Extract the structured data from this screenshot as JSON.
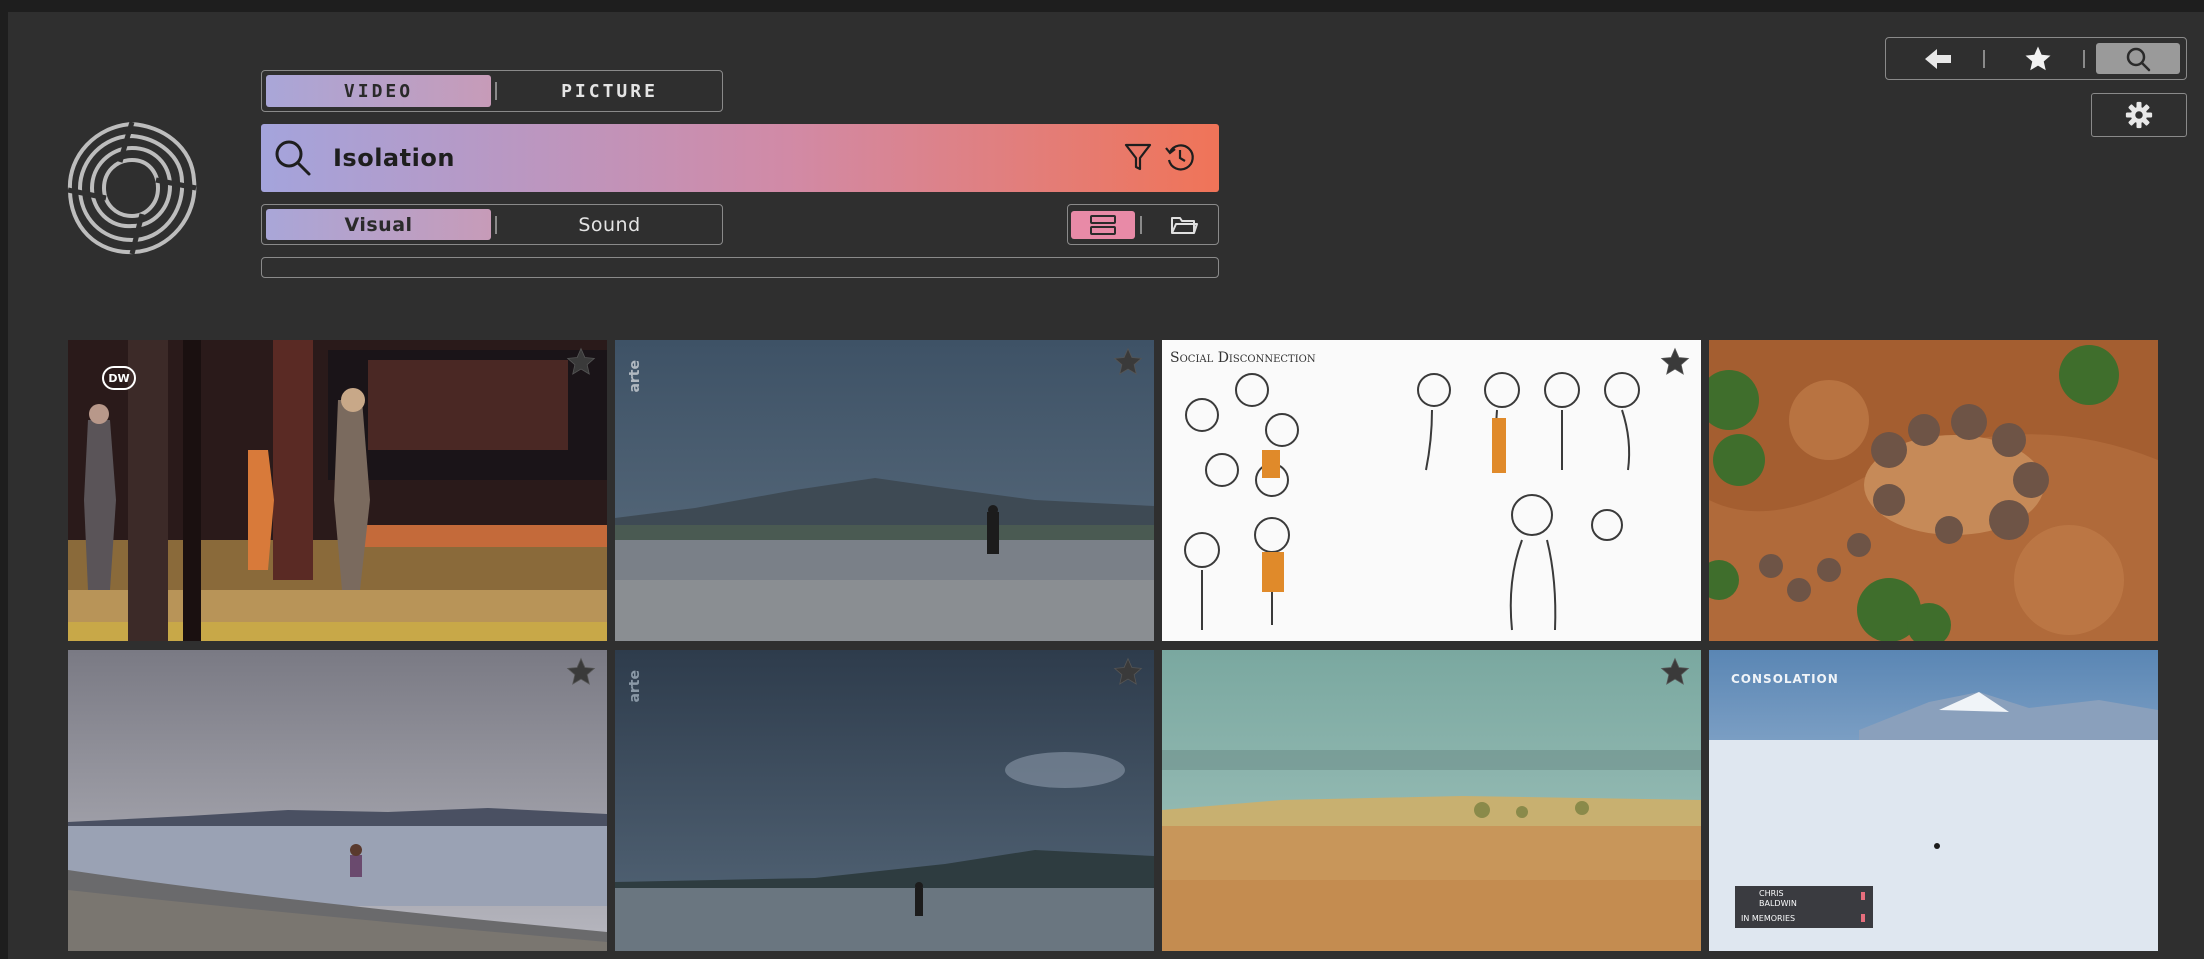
{
  "mode_tabs": [
    {
      "label": "VIDEO",
      "active": true
    },
    {
      "label": "PICTURE",
      "active": false
    }
  ],
  "search": {
    "query": "Isolation"
  },
  "match_tabs": [
    {
      "label": "Visual",
      "active": true
    },
    {
      "label": "Sound",
      "active": false
    }
  ],
  "view_toggle": {
    "active": "list-icon",
    "other": "folder-icon"
  },
  "top_nav": {
    "active": "search-icon",
    "items": [
      "back-arrow-icon",
      "star-icon",
      "search-icon"
    ]
  },
  "results": [
    {
      "badge": "DW",
      "starred": false
    },
    {
      "badge": "arte",
      "starred": false
    },
    {
      "caption": "Social Disconnection",
      "starred": false
    },
    {
      "starred": false
    },
    {
      "starred": false
    },
    {
      "badge": "arte",
      "starred": false
    },
    {
      "starred": false
    },
    {
      "badge": "CONSOLATION",
      "lower_third": [
        "CHRIS",
        "BALDWIN",
        "IN MEMORIES"
      ],
      "starred": false
    }
  ],
  "colors": {
    "background": "#2f2f2f",
    "search_gradient": [
      "#a4a4dc",
      "#d18aa6",
      "#f07458"
    ],
    "active_tab_gradient": [
      "#a9a6d8",
      "#c79bb8"
    ],
    "view_toggle_active": "#e88aa7"
  }
}
